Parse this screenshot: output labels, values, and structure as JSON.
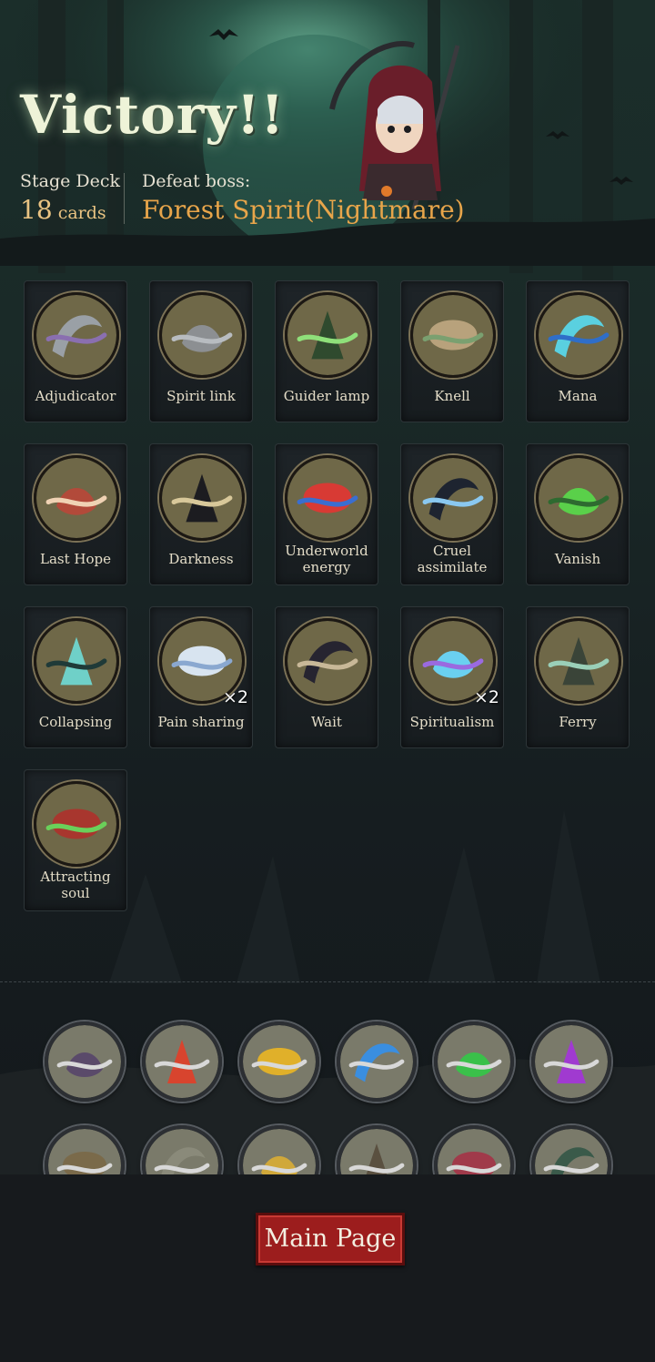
{
  "header": {
    "title": "Victory!!",
    "stage_deck_label": "Stage Deck",
    "stage_deck_count": "18",
    "stage_deck_unit": "cards",
    "defeat_boss_label": "Defeat boss:",
    "boss_name": "Forest Spirit(Nightmare)"
  },
  "cards": [
    {
      "name": "Adjudicator",
      "icon": "scythe-icon",
      "bg": "#6f6848",
      "fg": "#9aa0a6",
      "accent": "#8a6fb0"
    },
    {
      "name": "Spirit link",
      "icon": "chain-icon",
      "bg": "#6f6848",
      "fg": "#8c8f92",
      "accent": "#b8bcc0"
    },
    {
      "name": "Guider lamp",
      "icon": "lamp-icon",
      "bg": "#6f6848",
      "fg": "#2f4a2e",
      "accent": "#8fe07a"
    },
    {
      "name": "Knell",
      "icon": "bell-icon",
      "bg": "#6f6848",
      "fg": "#b8a27c",
      "accent": "#7aa070"
    },
    {
      "name": "Mana",
      "icon": "mana-orb-icon",
      "bg": "#6f6848",
      "fg": "#5ad0e0",
      "accent": "#2f6ec8"
    },
    {
      "name": "Last Hope",
      "icon": "girl-portrait-icon",
      "bg": "#6f6848",
      "fg": "#b24a3a",
      "accent": "#f0d2b4"
    },
    {
      "name": "Darkness",
      "icon": "reaper-icon",
      "bg": "#6f6848",
      "fg": "#1c1c20",
      "accent": "#d8c89a"
    },
    {
      "name": "Underworld energy",
      "icon": "fire-water-icon",
      "bg": "#6f6848",
      "fg": "#d83a34",
      "accent": "#3a6ed0"
    },
    {
      "name": "Cruel assimilate",
      "icon": "dark-knight-icon",
      "bg": "#6f6848",
      "fg": "#1e2430",
      "accent": "#8ac8f0"
    },
    {
      "name": "Vanish",
      "icon": "green-swirl-icon",
      "bg": "#6f6848",
      "fg": "#5ad04a",
      "accent": "#2e6a30"
    },
    {
      "name": "Collapsing",
      "icon": "ghost-skull-icon",
      "bg": "#6f6848",
      "fg": "#6fd0c8",
      "accent": "#1f3a38"
    },
    {
      "name": "Pain sharing",
      "icon": "ghost-icon",
      "bg": "#6f6848",
      "fg": "#d8e4f0",
      "accent": "#8aa8d0",
      "multiplier": "×2"
    },
    {
      "name": "Wait",
      "icon": "skeleton-icon",
      "bg": "#6f6848",
      "fg": "#262430",
      "accent": "#c8b898"
    },
    {
      "name": "Spiritualism",
      "icon": "spirit-wisp-icon",
      "bg": "#6f6848",
      "fg": "#6ad0f0",
      "accent": "#9a6ae0",
      "multiplier": "×2"
    },
    {
      "name": "Ferry",
      "icon": "boat-ferryman-icon",
      "bg": "#6f6848",
      "fg": "#3a4438",
      "accent": "#9acfb8"
    },
    {
      "name": "Attracting soul",
      "icon": "red-hood-girl-icon",
      "bg": "#6f6848",
      "fg": "#a8362e",
      "accent": "#6ad05a"
    }
  ],
  "rewards": [
    {
      "icon": "crow-relic-icon",
      "color": "#5a4a6a"
    },
    {
      "icon": "skull-music-red-icon",
      "color": "#d8442e"
    },
    {
      "icon": "skull-music-yellow-icon",
      "color": "#e0b02a"
    },
    {
      "icon": "skull-music-blue-icon",
      "color": "#3a8ee0"
    },
    {
      "icon": "skull-music-green-icon",
      "color": "#3ac04a"
    },
    {
      "icon": "skull-music-purple-icon",
      "color": "#a03ad0"
    },
    {
      "icon": "bird-relic-icon",
      "color": "#7a6a4a"
    },
    {
      "icon": "sword-relic-icon",
      "color": "#8a8a7a"
    },
    {
      "icon": "gold-coins-icon",
      "color": "#d0a83a"
    },
    {
      "icon": "witch-hat-icon",
      "color": "#5a5040"
    },
    {
      "icon": "vampire-icon",
      "color": "#a03a4a"
    },
    {
      "icon": "dark-castle-icon",
      "color": "#3a5a4a"
    }
  ],
  "footer": {
    "main_page_label": "Main Page"
  }
}
